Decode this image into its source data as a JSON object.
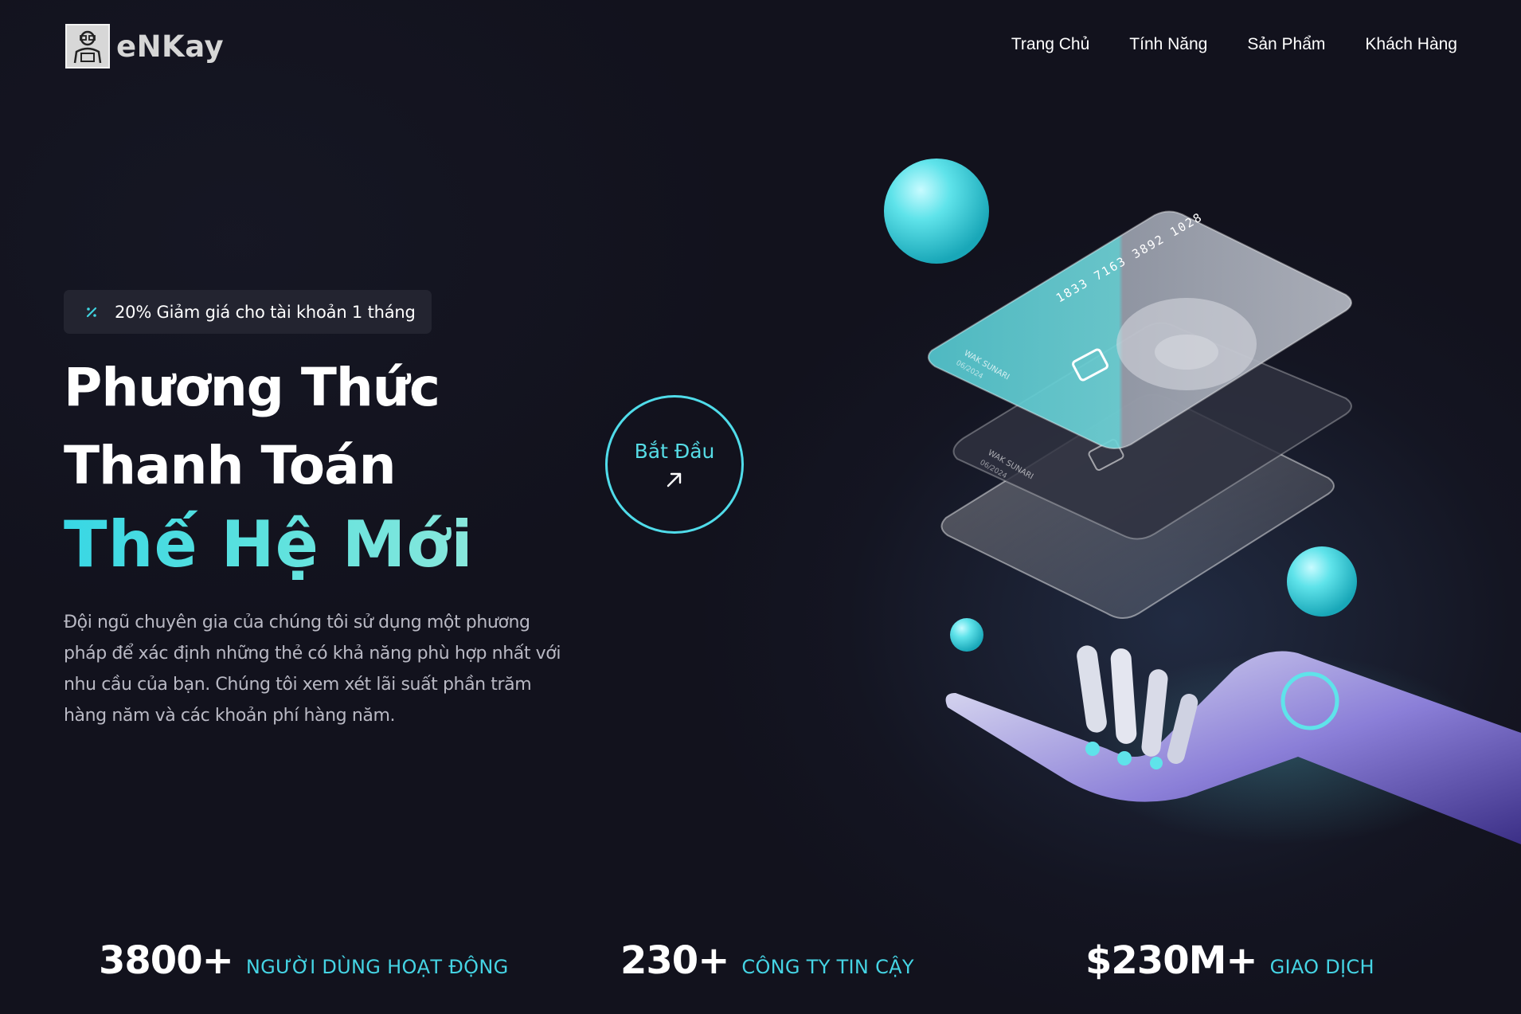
{
  "brand": {
    "name": "eNKay",
    "logo_icon": "person-with-glasses-icon"
  },
  "nav": {
    "items": [
      "Trang Chủ",
      "Tính Năng",
      "Sản Phẩm",
      "Khách Hàng"
    ]
  },
  "badge": {
    "icon": "percent-icon",
    "text": "20% Giảm giá cho tài khoản 1 tháng"
  },
  "hero": {
    "title_line1": "Phương Thức",
    "title_line2": "Thanh Toán",
    "title_accent": "Thế Hệ Mới",
    "description": "Đội ngũ chuyên gia của chúng tôi sử dụng một phương pháp để xác định những thẻ có khả năng phù hợp nhất với nhu cầu của bạn. Chúng tôi xem xét lãi suất phần trăm hàng năm và các khoản phí hàng năm."
  },
  "cta": {
    "label": "Bắt Đầu",
    "icon": "arrow-up-right-icon"
  },
  "cards": {
    "number": "1833 7163 3892 1028",
    "holder": "WAK SUNARI",
    "expiry": "06/2024"
  },
  "stats": [
    {
      "value": "3800+",
      "label": "NGƯỜI DÙNG HOẠT ĐỘNG"
    },
    {
      "value": "230+",
      "label": "CÔNG TY TIN CẬY"
    },
    {
      "value": "$230M+",
      "label": "GIAO DỊCH"
    }
  ],
  "colors": {
    "background": "#12121d",
    "accent": "#45d4e4",
    "badge_bg": "#232430",
    "text_muted": "#b9b9c4"
  }
}
